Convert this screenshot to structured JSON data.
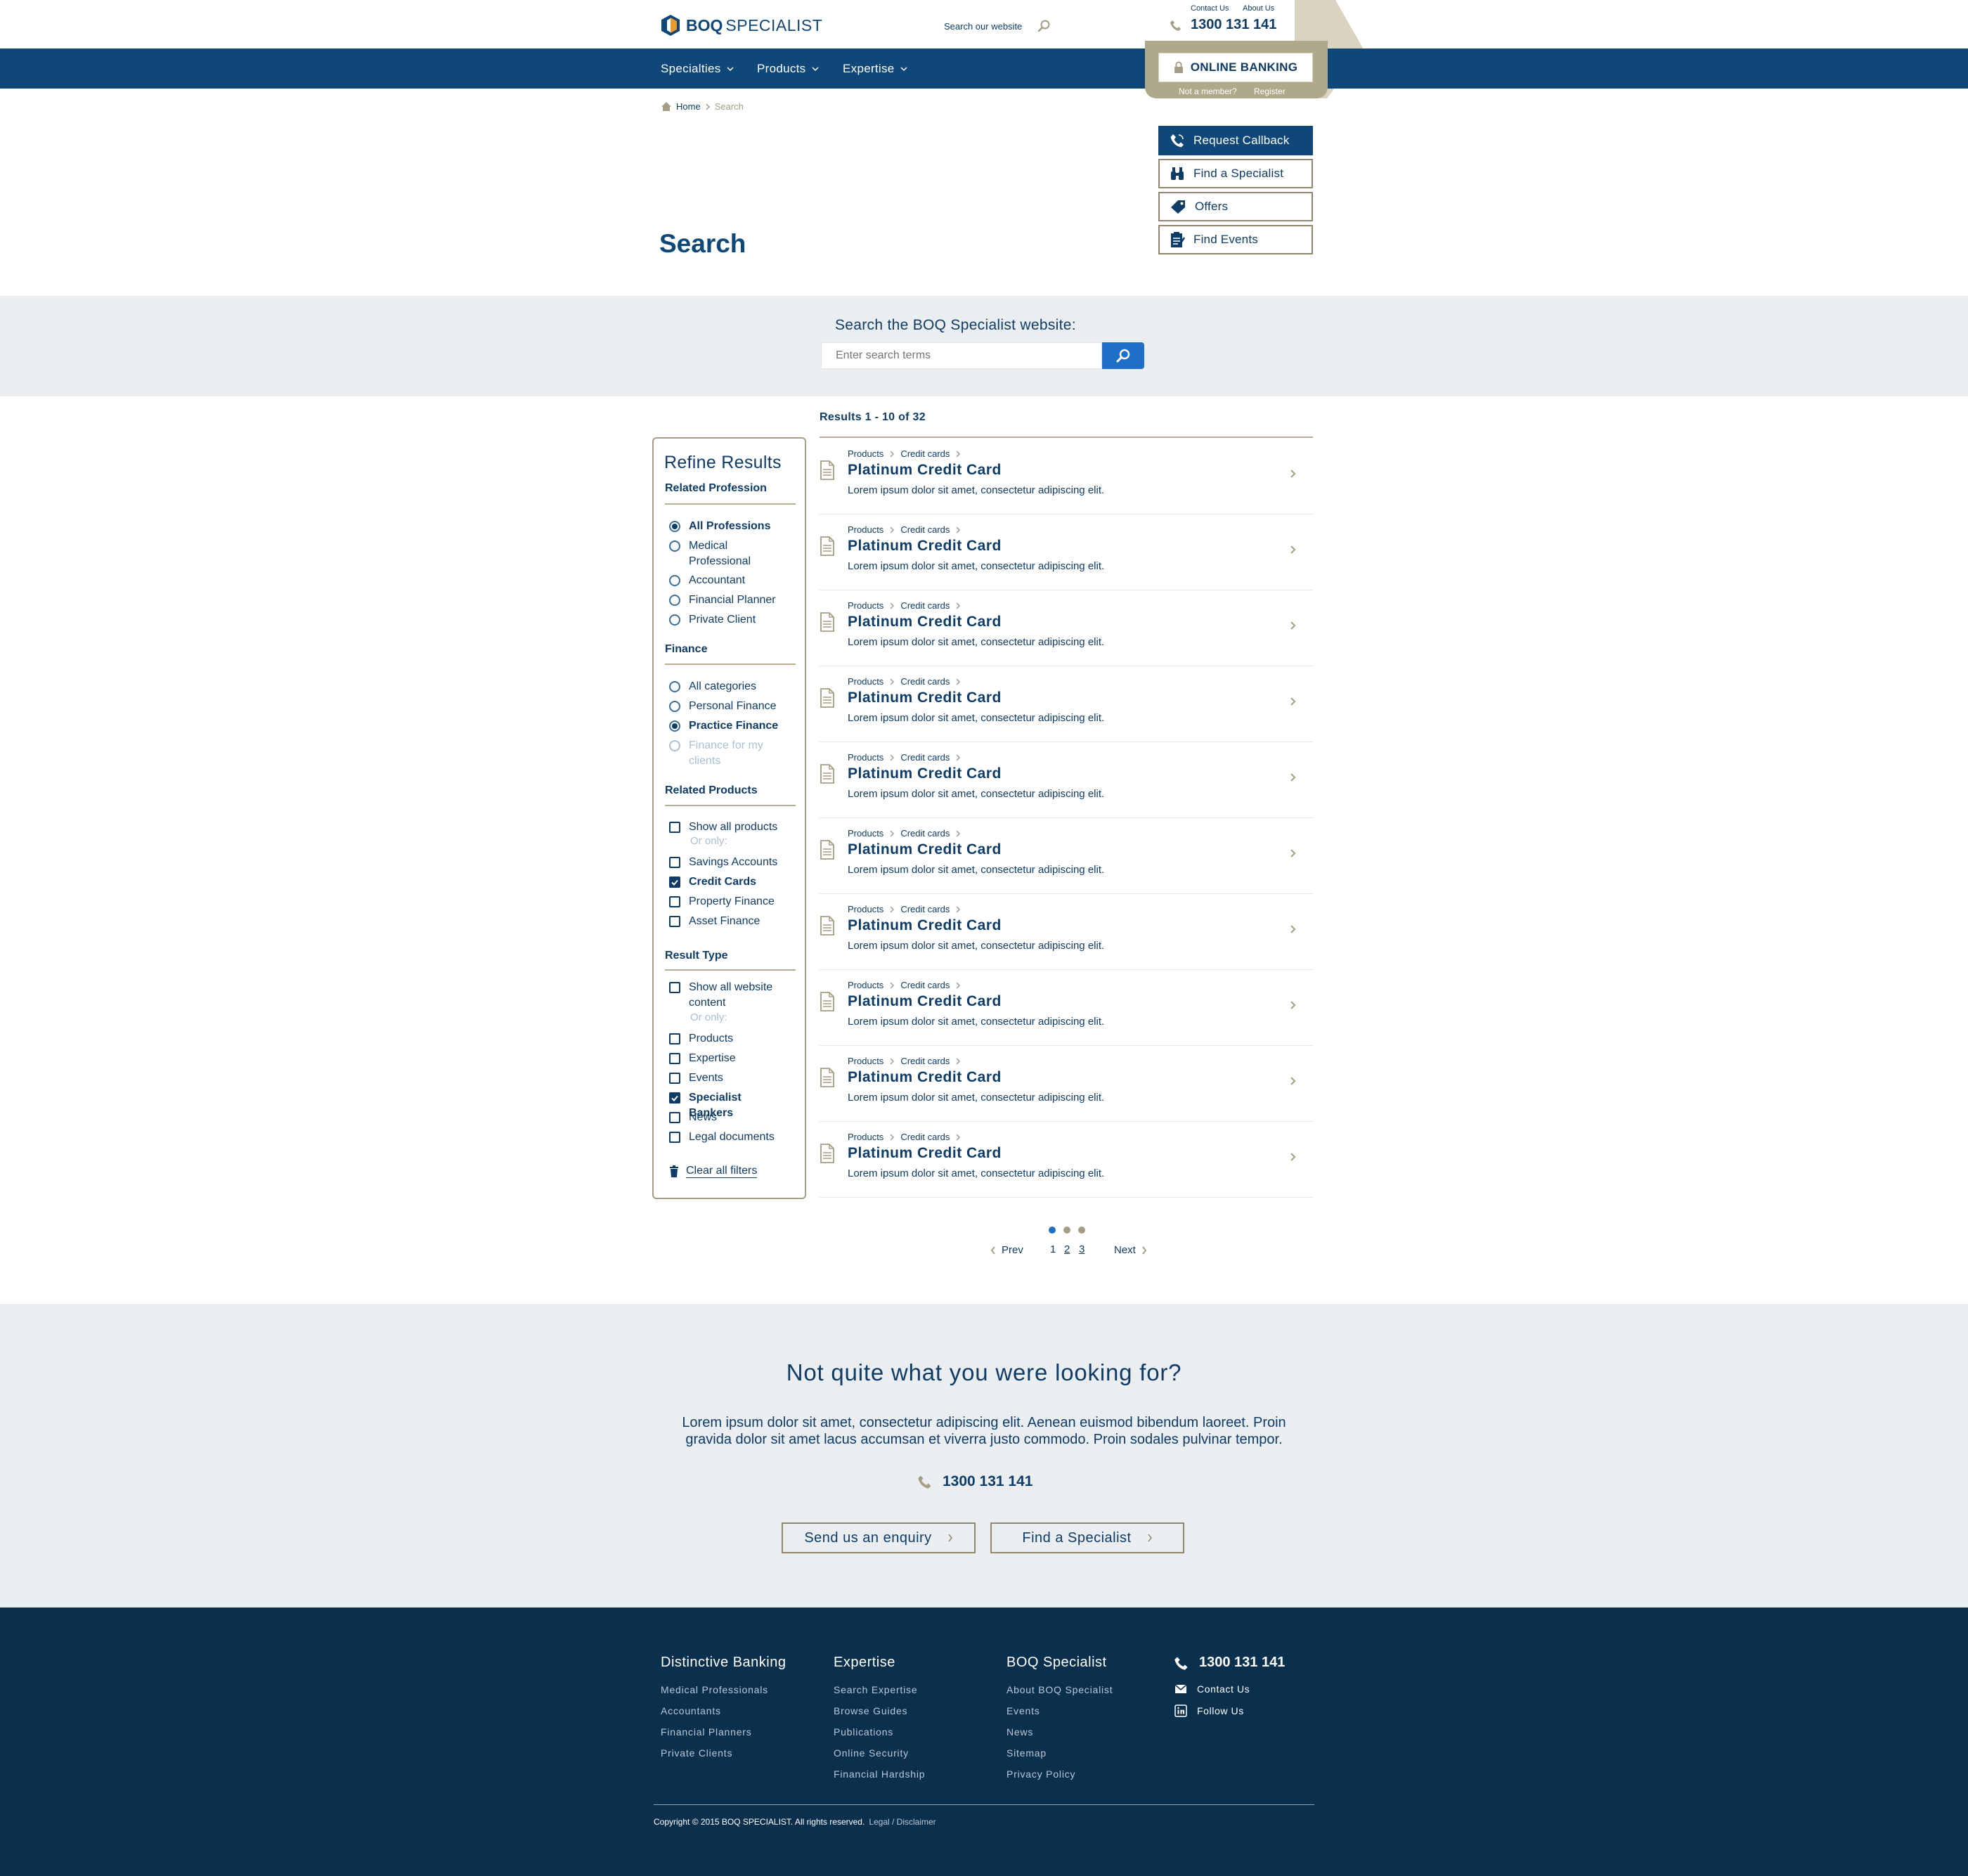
{
  "brand": {
    "name_bold": "BOQ",
    "name_rest": "SPECIALIST",
    "navy": "#0f4778",
    "gold": "#b0a88a",
    "blue": "#1f6fc9"
  },
  "header": {
    "top_links": [
      "Contact Us",
      "About Us"
    ],
    "search_label": "Search our website",
    "phone": "1300 131 141",
    "online_banking": "ONLINE BANKING",
    "not_member": "Not a member?",
    "register": "Register"
  },
  "nav": {
    "items": [
      "Specialties",
      "Products",
      "Expertise"
    ]
  },
  "breadcrumb": {
    "home": "Home",
    "current": "Search"
  },
  "side_buttons": [
    {
      "label": "Request Callback",
      "icon": "phone-icon"
    },
    {
      "label": "Find a Specialist",
      "icon": "binoculars-icon"
    },
    {
      "label": "Offers",
      "icon": "tag-icon"
    },
    {
      "label": "Find Events",
      "icon": "clipboard-icon"
    }
  ],
  "page_title": "Search",
  "search": {
    "heading": "Search the BOQ Specialist website:",
    "placeholder": "Enter search terms"
  },
  "results_count": "Results 1 - 10 of 32",
  "refine": {
    "title": "Refine Results",
    "sections": [
      {
        "title": "Related Profession",
        "options": [
          {
            "label": "All Professions",
            "selected": true
          },
          {
            "label": "Medical Professional",
            "selected": false
          },
          {
            "label": "Accountant",
            "selected": false
          },
          {
            "label": "Financial Planner",
            "selected": false
          },
          {
            "label": "Private Client",
            "selected": false
          }
        ]
      },
      {
        "title": "Finance",
        "options": [
          {
            "label": "All categories",
            "selected": false
          },
          {
            "label": "Personal Finance",
            "selected": false
          },
          {
            "label": "Practice Finance",
            "selected": true
          },
          {
            "label": "Finance for my clients",
            "selected": false,
            "disabled": true
          }
        ]
      },
      {
        "title": "Related Products",
        "or_only": "Or only:",
        "options": [
          {
            "label": "Show all products",
            "checked": false
          },
          {
            "label": "Savings Accounts",
            "checked": false
          },
          {
            "label": "Credit Cards",
            "checked": true
          },
          {
            "label": "Property Finance",
            "checked": false
          },
          {
            "label": "Asset Finance",
            "checked": false
          }
        ]
      },
      {
        "title": "Result Type",
        "or_only": "Or only:",
        "options": [
          {
            "label": "Show all website content",
            "checked": false
          },
          {
            "label": "Products",
            "checked": false
          },
          {
            "label": "Expertise",
            "checked": false
          },
          {
            "label": "Events",
            "checked": false
          },
          {
            "label": "Specialist Bankers",
            "checked": true
          },
          {
            "label": "News",
            "checked": false
          },
          {
            "label": "Legal documents",
            "checked": false
          }
        ]
      }
    ],
    "clear": "Clear all filters"
  },
  "results": [
    {
      "crumb1": "Products",
      "crumb2": "Credit cards",
      "title": "Platinum Credit Card",
      "desc": "Lorem ipsum dolor sit amet, consectetur adipiscing elit."
    },
    {
      "crumb1": "Products",
      "crumb2": "Credit cards",
      "title": "Platinum Credit Card",
      "desc": "Lorem ipsum dolor sit amet, consectetur adipiscing elit."
    },
    {
      "crumb1": "Products",
      "crumb2": "Credit cards",
      "title": "Platinum Credit Card",
      "desc": "Lorem ipsum dolor sit amet, consectetur adipiscing elit."
    },
    {
      "crumb1": "Products",
      "crumb2": "Credit cards",
      "title": "Platinum Credit Card",
      "desc": "Lorem ipsum dolor sit amet, consectetur adipiscing elit."
    },
    {
      "crumb1": "Products",
      "crumb2": "Credit cards",
      "title": "Platinum Credit Card",
      "desc": "Lorem ipsum dolor sit amet, consectetur adipiscing elit."
    },
    {
      "crumb1": "Products",
      "crumb2": "Credit cards",
      "title": "Platinum Credit Card",
      "desc": "Lorem ipsum dolor sit amet, consectetur adipiscing elit."
    },
    {
      "crumb1": "Products",
      "crumb2": "Credit cards",
      "title": "Platinum Credit Card",
      "desc": "Lorem ipsum dolor sit amet, consectetur adipiscing elit."
    },
    {
      "crumb1": "Products",
      "crumb2": "Credit cards",
      "title": "Platinum Credit Card",
      "desc": "Lorem ipsum dolor sit amet, consectetur adipiscing elit."
    },
    {
      "crumb1": "Products",
      "crumb2": "Credit cards",
      "title": "Platinum Credit Card",
      "desc": "Lorem ipsum dolor sit amet, consectetur adipiscing elit."
    },
    {
      "crumb1": "Products",
      "crumb2": "Credit cards",
      "title": "Platinum Credit Card",
      "desc": "Lorem ipsum dolor sit amet, consectetur adipiscing elit."
    }
  ],
  "pagination": {
    "prev": "Prev",
    "next": "Next",
    "pages": [
      "1",
      "2",
      "3"
    ],
    "current": 1
  },
  "cta": {
    "heading": "Not quite what you were looking for?",
    "body1": "Lorem ipsum dolor sit amet, consectetur adipiscing elit. Aenean euismod bibendum laoreet. Proin",
    "body2": "gravida dolor sit amet lacus accumsan et viverra justo commodo. Proin sodales pulvinar tempor.",
    "phone": "1300 131 141",
    "enquiry": "Send us an enquiry",
    "specialist": "Find a Specialist"
  },
  "footer": {
    "columns": [
      {
        "title": "Distinctive Banking",
        "links": [
          "Medical Professionals",
          "Accountants",
          "Financial Planners",
          "Private Clients"
        ]
      },
      {
        "title": "Expertise",
        "links": [
          "Search Expertise",
          "Browse Guides",
          "Publications",
          "Online Security",
          "Financial Hardship"
        ]
      },
      {
        "title": "BOQ Specialist",
        "links": [
          "About BOQ Specialist",
          "Events",
          "News",
          "Sitemap",
          "Privacy Policy"
        ]
      }
    ],
    "phone": "1300 131 141",
    "contact": "Contact Us",
    "follow": "Follow Us",
    "copyright": "Copyright © 2015 BOQ SPECIALIST. All rights reserved.",
    "legal": "Legal / Disclaimer"
  }
}
